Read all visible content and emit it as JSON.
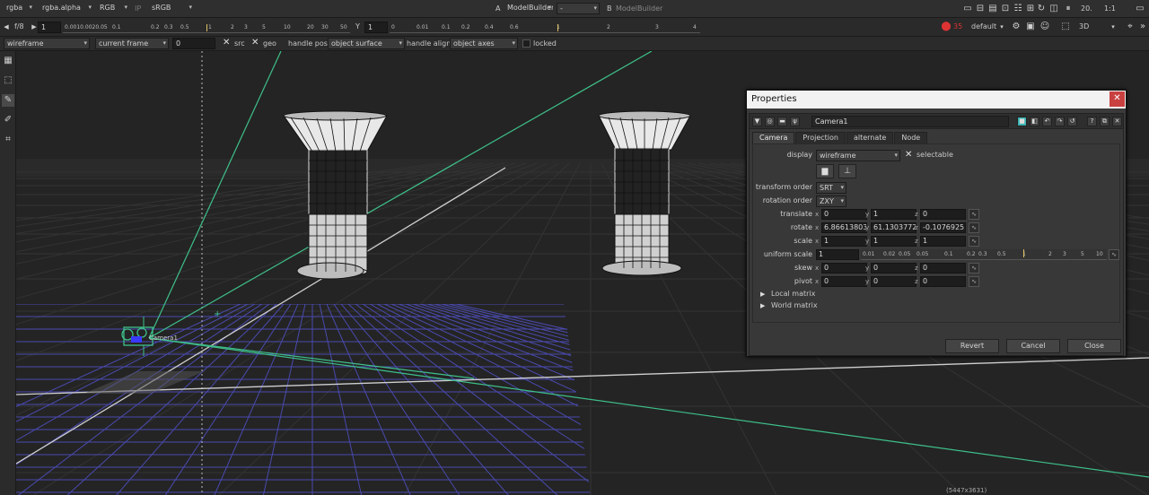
{
  "top_bar": {
    "channels": "rgba",
    "alpha": "rgba.alpha",
    "display_channel": "RGB",
    "ip": "IP",
    "colorspace": "sRGB",
    "input_a_label": "A",
    "input_a": "ModelBuilder",
    "input_mode": "-",
    "input_b_label": "B",
    "input_b": "ModelBuilder",
    "zoom": "20.",
    "proxy": "1:1"
  },
  "second_bar": {
    "fstop": "f/8",
    "gain": "1",
    "gain_ticks": [
      "0.0010.0020.05",
      "0.1",
      "0.2",
      "0.3",
      "0.5",
      "1",
      "2",
      "3",
      "5",
      "10",
      "20",
      "30",
      "50"
    ],
    "gamma_label": "Y",
    "gamma": "1",
    "gamma_ticks": [
      "0",
      "0.01",
      "0.1",
      "0.2",
      "0.4",
      "0.6",
      "1",
      "2",
      "3",
      "4"
    ],
    "stop_frame": "35",
    "lut": "default",
    "view_mode": "3D"
  },
  "third_bar": {
    "render_mode": "wireframe",
    "frame_mode": "current frame",
    "frame_value": "0",
    "src_label": "src",
    "geo_label": "geo",
    "handle_pos_label": "handle pos",
    "handle_pos": "object surface",
    "handle_align_label": "handle align",
    "handle_align": "object axes",
    "locked_label": "locked"
  },
  "viewport": {
    "camera_label": "Camera1",
    "resolution": "(5447x3631)"
  },
  "properties": {
    "title": "Properties",
    "node_name": "Camera1",
    "tabs": [
      "Camera",
      "Projection",
      "alternate",
      "Node"
    ],
    "display_label": "display",
    "display_value": "wireframe",
    "selectable_label": "selectable",
    "transform_order_label": "transform order",
    "transform_order": "SRT",
    "rotation_order_label": "rotation order",
    "rotation_order": "ZXY",
    "translate_label": "translate",
    "translate": {
      "x": "0",
      "y": "1",
      "z": "0"
    },
    "rotate_label": "rotate",
    "rotate": {
      "x": "6.86613803",
      "y": "61.1303772",
      "z": "-0.1076925"
    },
    "scale_label": "scale",
    "scale": {
      "x": "1",
      "y": "1",
      "z": "1"
    },
    "uniform_scale_label": "uniform scale",
    "uniform_scale": "1",
    "uniform_ticks": [
      "0.01",
      "0.02",
      "0.05",
      "0.05",
      "0.1",
      "0.2",
      "0.3",
      "0.5",
      "1",
      "2",
      "3",
      "5",
      "10"
    ],
    "skew_label": "skew",
    "skew": {
      "x": "0",
      "y": "0",
      "z": "0"
    },
    "pivot_label": "pivot",
    "pivot": {
      "x": "0",
      "y": "0",
      "z": "0"
    },
    "axis_x": "x",
    "axis_y": "y",
    "axis_z": "z",
    "local_matrix_label": "Local matrix",
    "world_matrix_label": "World matrix",
    "revert_label": "Revert",
    "cancel_label": "Cancel",
    "close_label": "Close"
  }
}
